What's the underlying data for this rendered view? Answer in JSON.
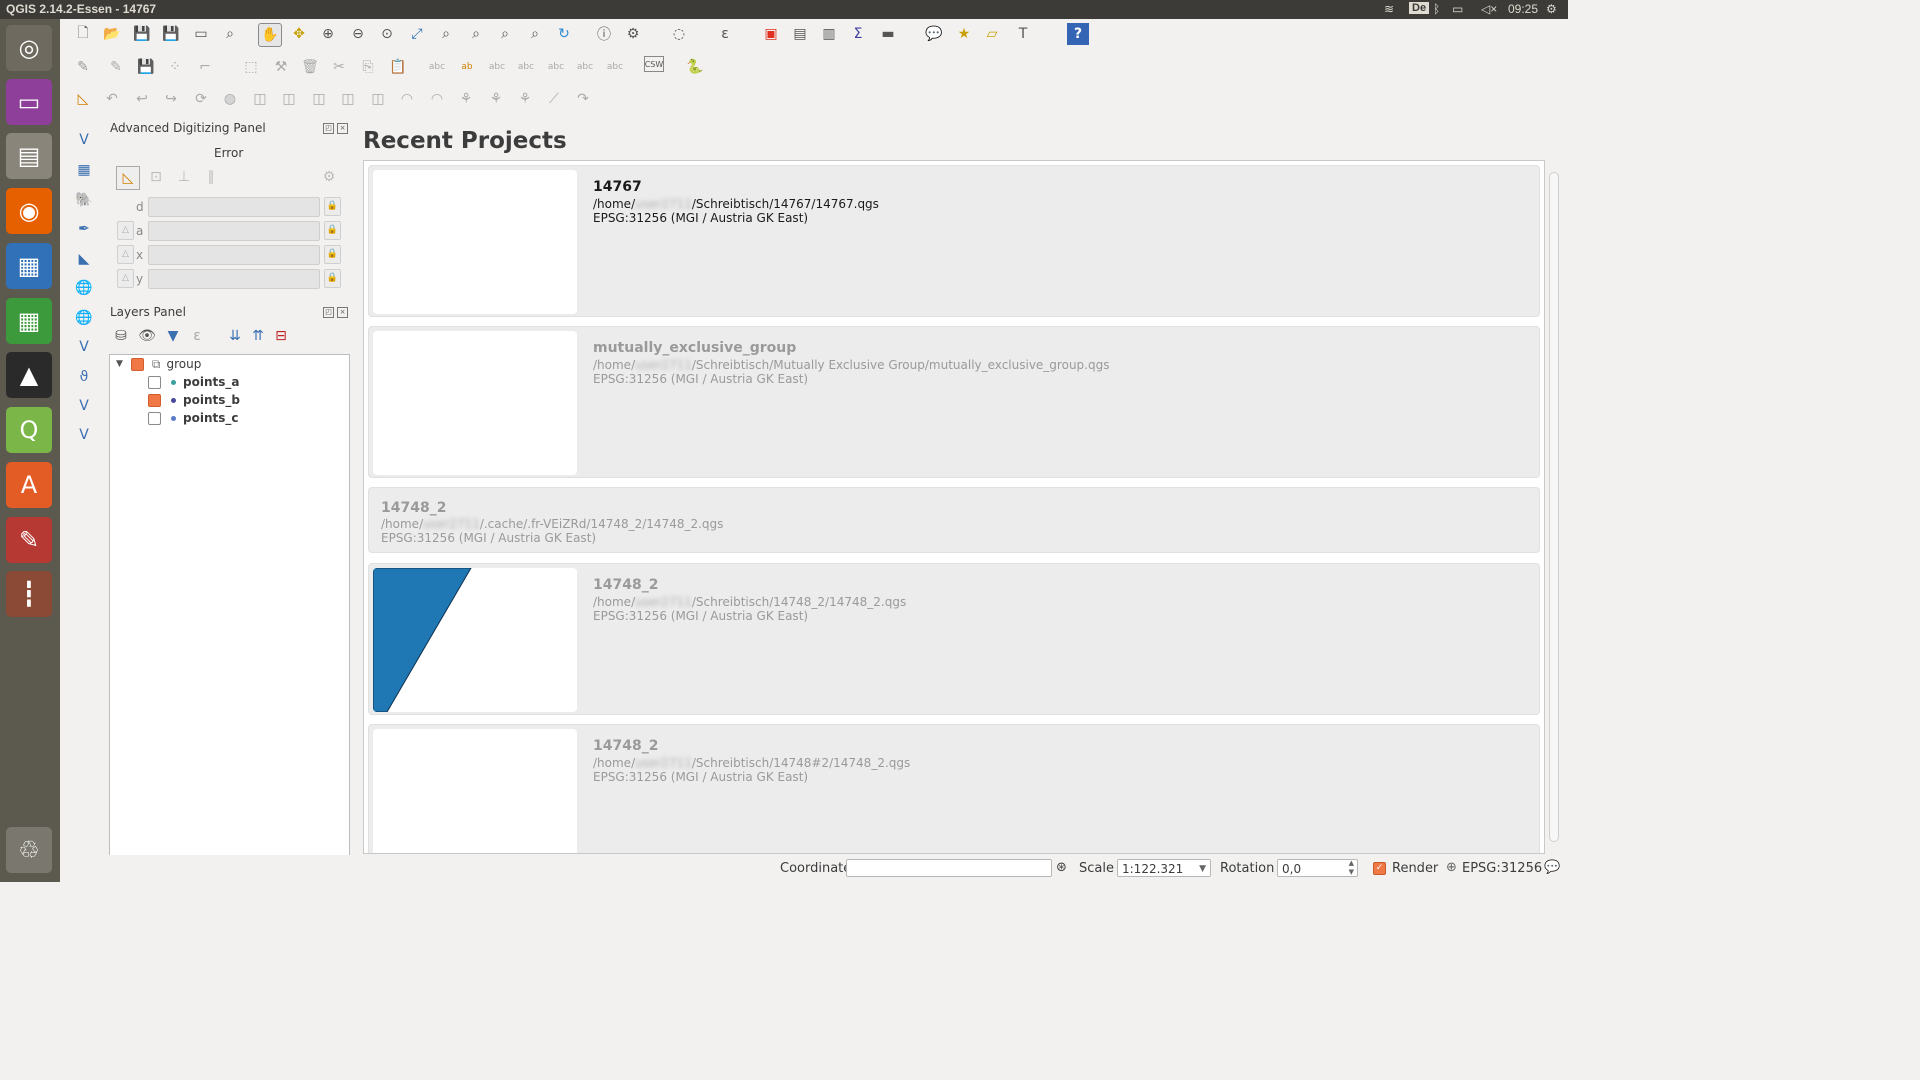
{
  "window": {
    "title": "QGIS 2.14.2-Essen - 14767"
  },
  "system": {
    "keyboard_layout": "De",
    "time": "09:25",
    "indicators": [
      "wifi-icon",
      "bluetooth-icon",
      "battery-icon",
      "volume-muted-icon",
      "gear-icon"
    ]
  },
  "launcher": {
    "items": [
      {
        "name": "ubuntu-dash-icon",
        "glyph": "◎",
        "bg": "#6e6a5f"
      },
      {
        "name": "workspace-switcher-icon",
        "glyph": "▭",
        "bg": "#8e3f9a"
      },
      {
        "name": "file-manager-icon",
        "glyph": "▤",
        "bg": "#8a857a"
      },
      {
        "name": "firefox-icon",
        "glyph": "◉",
        "bg": "#e66000"
      },
      {
        "name": "libreoffice-impress-icon",
        "glyph": "▦",
        "bg": "#3071b8"
      },
      {
        "name": "libreoffice-calc-icon",
        "glyph": "▦",
        "bg": "#3c9a3c"
      },
      {
        "name": "inkscape-icon",
        "glyph": "▲",
        "bg": "#2a2a2a"
      },
      {
        "name": "qgis-icon",
        "glyph": "Q",
        "bg": "#7ab648"
      },
      {
        "name": "software-center-icon",
        "glyph": "A",
        "bg": "#e35b25"
      },
      {
        "name": "system-settings-icon",
        "glyph": "✎",
        "bg": "#b63a33"
      },
      {
        "name": "mixer-icon",
        "glyph": "┇",
        "bg": "#8a4a36"
      },
      {
        "name": "trash-icon",
        "glyph": "♲",
        "bg": "#7a786e"
      }
    ]
  },
  "digitizing_panel": {
    "title": "Advanced Digitizing Panel",
    "status": "Error",
    "fields": [
      {
        "label": "d",
        "value": ""
      },
      {
        "label": "a",
        "value": ""
      },
      {
        "label": "x",
        "value": ""
      },
      {
        "label": "y",
        "value": ""
      }
    ]
  },
  "layers_panel": {
    "title": "Layers Panel",
    "group": {
      "name": "group",
      "color": "#f07746"
    },
    "layers": [
      {
        "name": "points_a",
        "checked": false,
        "color": "#3aa0a0"
      },
      {
        "name": "points_b",
        "checked": true,
        "color": "#4a4a9a"
      },
      {
        "name": "points_c",
        "checked": false,
        "color": "#5a7ac8"
      }
    ]
  },
  "recent_projects": {
    "heading": "Recent Projects",
    "projects": [
      {
        "name": "14767",
        "path_prefix": "/home/",
        "user": "user2711",
        "path_suffix": "/Schreibtisch/14767/14767.qgs",
        "crs": "EPSG:31256 (MGI / Austria GK East)",
        "state": "active",
        "thumbnail": "blank"
      },
      {
        "name": "mutually_exclusive_group",
        "path_prefix": "/home/",
        "user": "user2711",
        "path_suffix": "/Schreibtisch/Mutually Exclusive Group/mutually_exclusive_group.qgs",
        "crs": "EPSG:31256 (MGI / Austria GK East)",
        "state": "dim",
        "thumbnail": "blank"
      },
      {
        "name": "14748_2",
        "path_prefix": "/home/",
        "user": "user2711",
        "path_suffix": "/.cache/.fr-VEiZRd/14748_2/14748_2.qgs",
        "crs": "EPSG:31256 (MGI / Austria GK East)",
        "state": "dim",
        "thumbnail": "none"
      },
      {
        "name": "14748_2",
        "path_prefix": "/home/",
        "user": "user2711",
        "path_suffix": "/Schreibtisch/14748_2/14748_2.qgs",
        "crs": "EPSG:31256 (MGI / Austria GK East)",
        "state": "dim",
        "thumbnail": "blue-polygon"
      },
      {
        "name": "14748_2",
        "path_prefix": "/home/",
        "user": "user2711",
        "path_suffix": "/Schreibtisch/14748#2/14748_2.qgs",
        "crs": "EPSG:31256 (MGI / Austria GK East)",
        "state": "dim",
        "thumbnail": "blank"
      }
    ],
    "thumbnail_color": "#1f78b4"
  },
  "statusbar": {
    "coordinate_label": "Coordinate",
    "coordinate_value": "",
    "scale_label": "Scale",
    "scale_value": "1:122.321",
    "rotation_label": "Rotation",
    "rotation_value": "0,0",
    "render_label": "Render",
    "render_checked": true,
    "crs": "EPSG:31256"
  }
}
